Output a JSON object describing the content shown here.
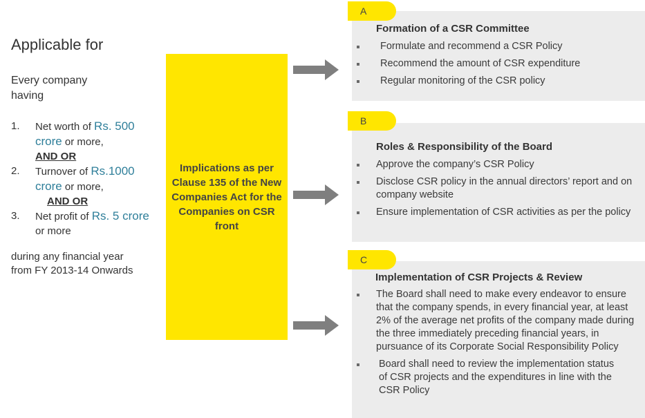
{
  "left": {
    "title": "Applicable for",
    "subtitle": "Every company having",
    "criteria": [
      {
        "num": "1.",
        "pre": "Net worth of ",
        "hl": "Rs. 500 crore",
        "post": " or more,"
      },
      {
        "num": "2.",
        "pre": "Turnover of ",
        "hl": "Rs.1000 crore",
        "post": " or more,"
      },
      {
        "num": "3.",
        "pre": "Net profit of ",
        "hl": "Rs. 5 crore",
        "post": " or more"
      }
    ],
    "and_or": "AND OR",
    "footer": "during any financial year from FY 2013-14 Onwards"
  },
  "center": {
    "text": "Implications as per Clause 135 of the New Companies Act for the Companies on CSR front"
  },
  "panels": [
    {
      "tab": "A",
      "title": "Formation of a CSR Committee",
      "items": [
        "Formulate and recommend a CSR Policy",
        "Recommend the amount of CSR expenditure",
        "Regular monitoring of the CSR policy"
      ]
    },
    {
      "tab": "B",
      "title": "Roles & Responsibility of the Board",
      "items": [
        "Approve the company’s CSR Policy",
        "Disclose CSR policy in the annual directors’ report and on company website",
        "Ensure implementation of CSR activities as per the policy"
      ]
    },
    {
      "tab": "C",
      "title": "Implementation of CSR Projects & Review",
      "items": [
        "The Board shall need to make every endeavor to ensure that the company spends, in every financial year, at least 2% of the average net profits of the company made during the three immediately preceding financial years, in pursuance of its Corporate Social Responsibility Policy",
        "Board shall need to review the implementation status of CSR projects and the expenditures in line with the CSR Policy"
      ]
    }
  ],
  "colors": {
    "accent_yellow": "#ffe600",
    "highlight_teal": "#2f7f9a",
    "panel_grey": "#ececec",
    "arrow_grey": "#7f7f7f"
  }
}
